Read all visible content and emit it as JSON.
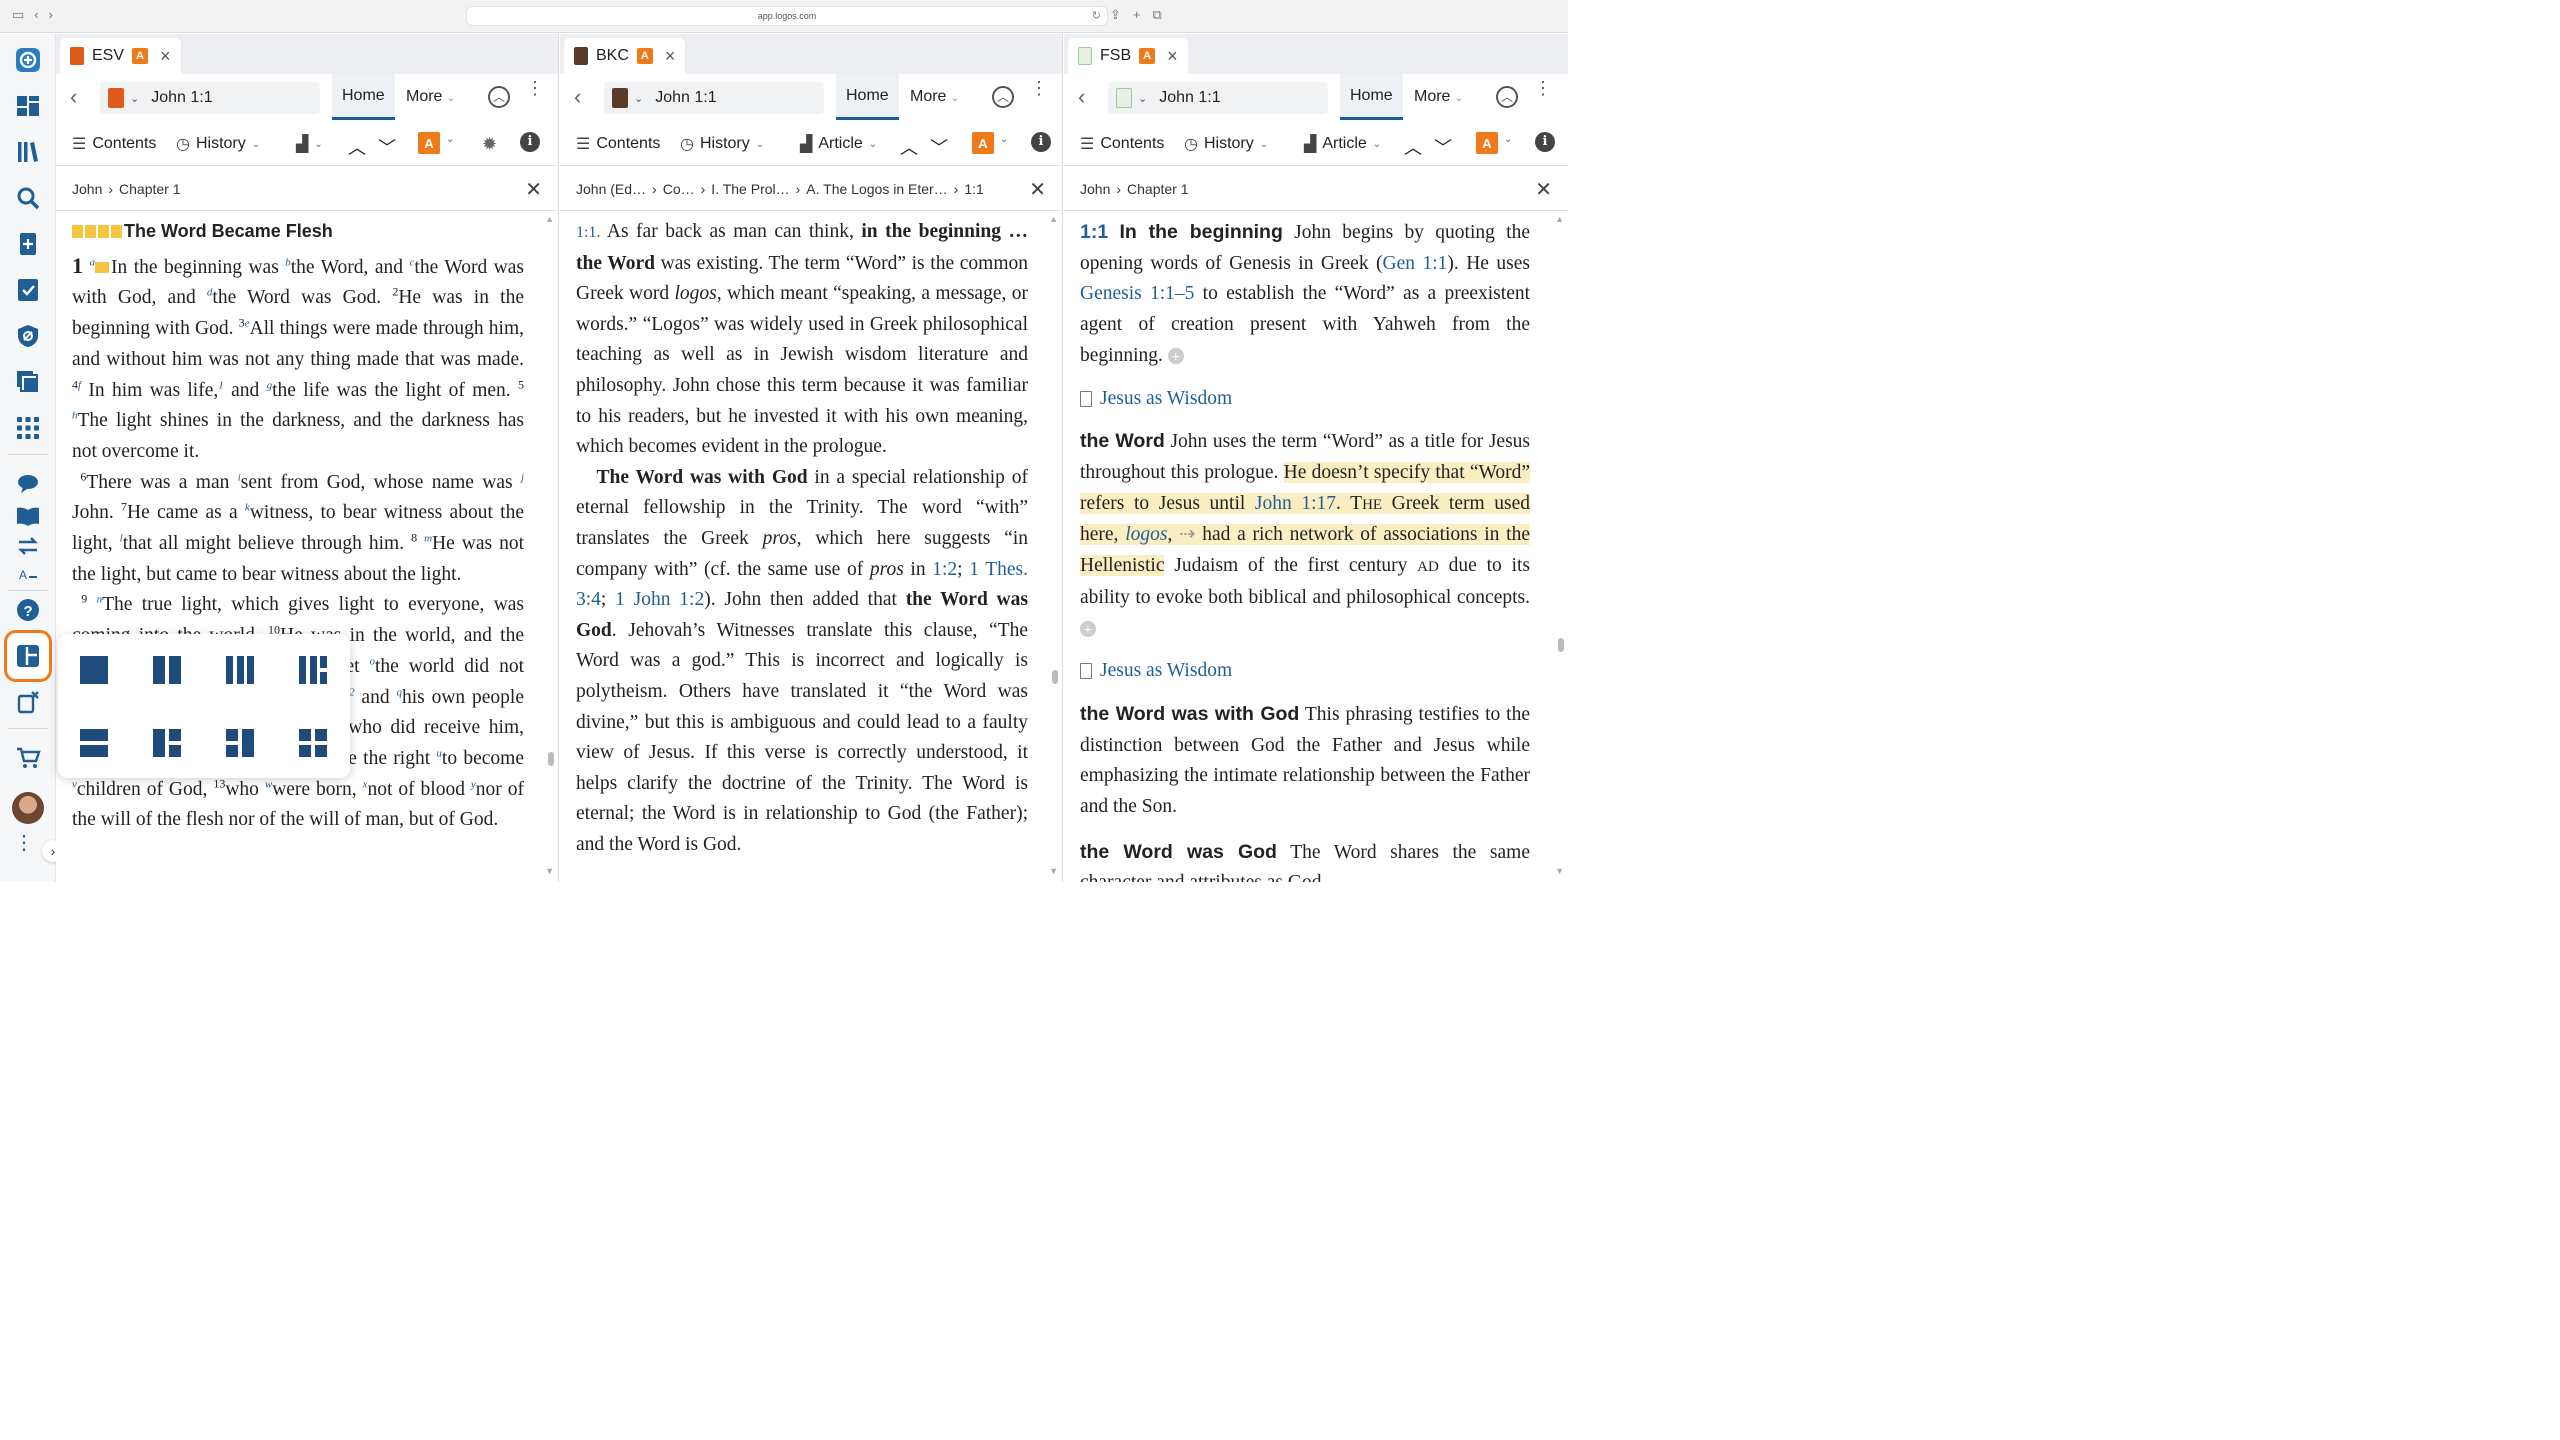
{
  "browser": {
    "url": "app.logos.com"
  },
  "colors": {
    "accent": "#1f5f96",
    "orange": "#ef7a1a",
    "highlight": "#fbeec2"
  },
  "rail": {
    "icons": [
      "logos-icon",
      "dashboard-icon",
      "library-icon",
      "search-icon",
      "add-doc-icon",
      "checklist-icon",
      "shield-icon",
      "layers-icon",
      "apps-icon",
      "chat-icon",
      "reading-plan-icon",
      "swap-icon",
      "text-size-icon",
      "help-icon",
      "layouts-icon",
      "close-panel-icon",
      "cart-icon",
      "avatar",
      "more-icon"
    ]
  },
  "panes": [
    {
      "tab": "ESV",
      "ref": "John 1:1",
      "home": "Home",
      "more": "More",
      "tools": {
        "contents": "Contents",
        "history": "History"
      },
      "crumbs": [
        "John",
        "Chapter 1"
      ],
      "heading": "The Word Became Flesh"
    },
    {
      "tab": "BKC",
      "ref": "John 1:1",
      "home": "Home",
      "more": "More",
      "tools": {
        "contents": "Contents",
        "history": "History",
        "article": "Article"
      },
      "crumbs": [
        "John (Ed…",
        "Co…",
        "I. The Prol…",
        "A. The Logos in Eter…",
        "1:1"
      ]
    },
    {
      "tab": "FSB",
      "ref": "John 1:1",
      "home": "Home",
      "more": "More",
      "tools": {
        "contents": "Contents",
        "history": "History",
        "article": "Article"
      },
      "crumbs": [
        "John",
        "Chapter 1"
      ],
      "links": {
        "jaw1": "Jesus as Wisdom",
        "jaw2": "Jesus as Wisdom"
      }
    }
  ],
  "layout_popup": {
    "options": [
      "single",
      "two-column",
      "three-column",
      "mixed-columns",
      "two-row",
      "grid-left",
      "grid-right",
      "four-grid"
    ]
  }
}
